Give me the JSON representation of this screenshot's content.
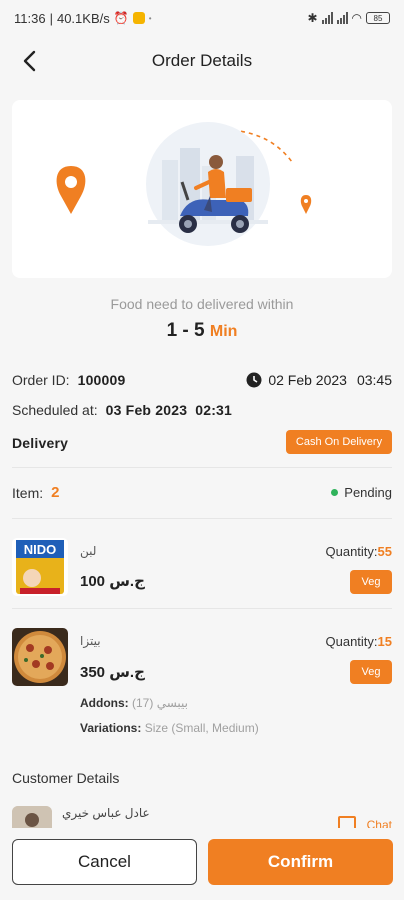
{
  "status_bar": {
    "time": "11:36",
    "net_speed": "40.1KB/s",
    "battery": "85"
  },
  "header": {
    "title": "Order Details"
  },
  "delivery_eta": {
    "label": "Food need to delivered within",
    "range": "1 - 5",
    "unit": "Min"
  },
  "order": {
    "id_label": "Order ID:",
    "id": "100009",
    "date": "02 Feb 2023",
    "time": "03:45",
    "scheduled_label": "Scheduled at:",
    "scheduled_date": "03 Feb 2023",
    "scheduled_time": "02:31",
    "type": "Delivery",
    "payment": "Cash On Delivery",
    "item_label": "Item:",
    "item_count": "2",
    "status": "Pending"
  },
  "items": [
    {
      "name": "لبن",
      "price": "100 ج.س",
      "quantity_label": "Quantity:",
      "quantity": "55",
      "tag": "Veg"
    },
    {
      "name": "بيتزا",
      "price": "350 ج.س",
      "quantity_label": "Quantity:",
      "quantity": "15",
      "tag": "Veg",
      "addons_label": "Addons:",
      "addons": "بيبسي (17)",
      "variations_label": "Variations:",
      "variations": "Size (Small, Medium)"
    }
  ],
  "customer": {
    "section_title": "Customer Details",
    "name": "عادل عباس خيري",
    "chat_label": "Chat"
  },
  "actions": {
    "cancel": "Cancel",
    "confirm": "Confirm"
  },
  "colors": {
    "accent": "#f07f22",
    "status_pending": "#2fb35b"
  }
}
